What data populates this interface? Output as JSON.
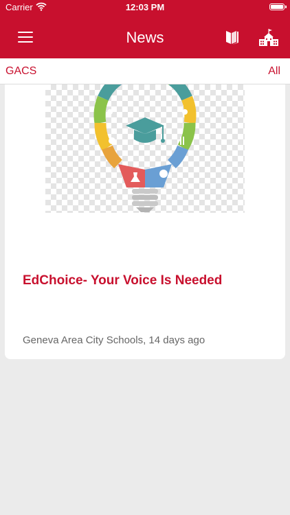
{
  "status_bar": {
    "carrier": "Carrier",
    "time": "12:03 PM"
  },
  "nav": {
    "title": "News",
    "menu_icon": "hamburger-menu-icon",
    "book_icon": "book-icon",
    "school_icon": "school-building-icon"
  },
  "filter": {
    "left_label": "GACS",
    "right_label": "All"
  },
  "article": {
    "headline": "EdChoice- Your Voice Is Needed",
    "source": "Geneva Area City Schools",
    "age": "14 days ago",
    "meta": "Geneva Area City Schools, 14 days ago",
    "image_icon": "lightbulb-graduation-icon"
  },
  "colors": {
    "brand": "#c8102e",
    "background": "#ebebeb",
    "card": "#ffffff"
  }
}
